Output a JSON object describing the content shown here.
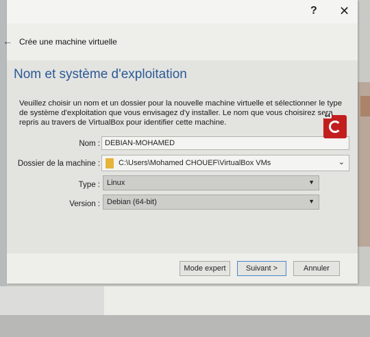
{
  "dialog": {
    "help_symbol": "?",
    "close_symbol": "✕",
    "wizard_title": "Crée une machine virtuelle",
    "section_heading": "Nom et système d'exploitation",
    "description_lines": [
      "Veuillez choisir un nom et un dossier pour la nouvelle machine virtuelle et sélectionner le type",
      "de système d'exploitation que vous envisagez d'y installer. Le nom que vous choisirez sera",
      "repris au travers de VirtualBox pour identifier cette machine."
    ]
  },
  "form": {
    "name_label": "Nom :",
    "name_value": "DEBIAN-MOHAMED",
    "folder_label": "Dossier de la machine :",
    "folder_value": "C:\\Users\\Mohamed CHOUEF\\VirtualBox VMs",
    "type_label": "Type :",
    "type_value": "Linux",
    "version_label": "Version :",
    "version_value": "Debian (64-bit)",
    "os_badge": "64"
  },
  "buttons": {
    "expert": "Mode expert",
    "next": "Suivant >",
    "cancel": "Annuler"
  },
  "colors": {
    "heading": "#2a5a95",
    "os_icon": "#c21e1e",
    "folder_icon": "#e7b43a"
  }
}
